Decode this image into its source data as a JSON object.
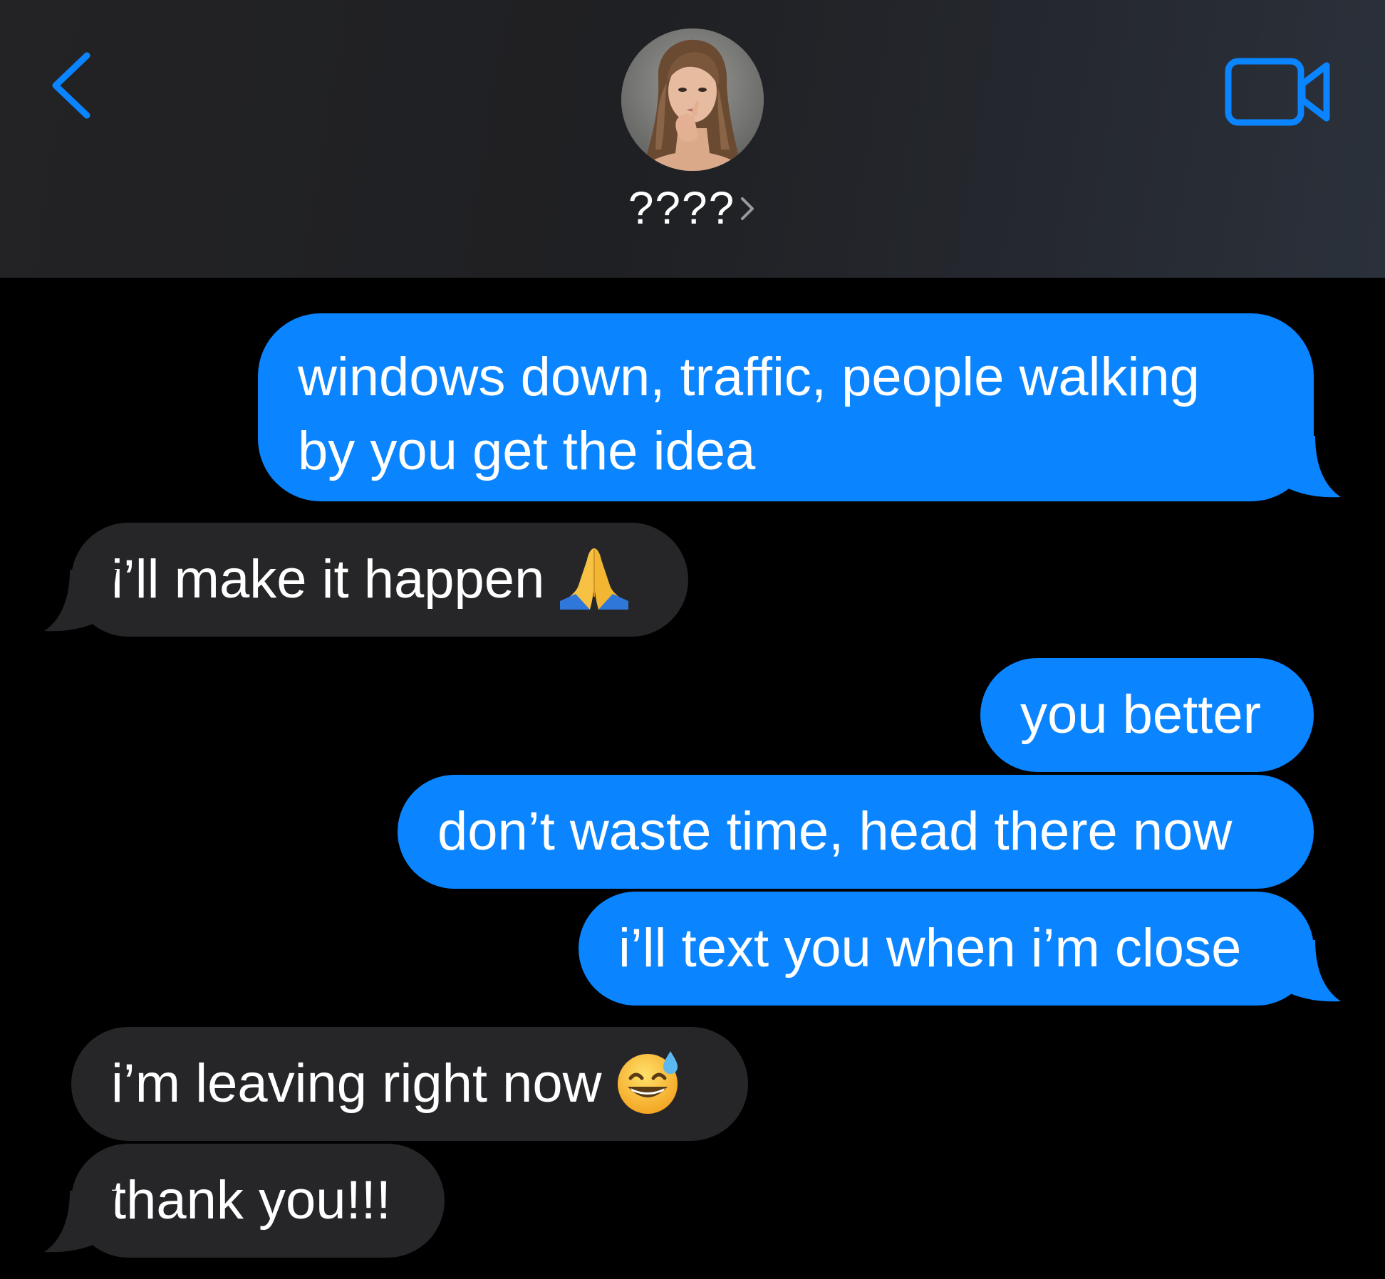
{
  "header": {
    "contact_name": "????",
    "back_icon": "chevron-left-icon",
    "video_icon": "video-camera-icon",
    "details_icon": "chevron-right-icon",
    "accent_color": "#0a84ff"
  },
  "messages": [
    {
      "direction": "sent",
      "line1": "windows down, traffic, people walking",
      "line2": "by you get the idea"
    },
    {
      "direction": "received",
      "text": "i’ll make it happen",
      "emoji": "folded-hands-emoji"
    },
    {
      "direction": "sent",
      "text": "you better"
    },
    {
      "direction": "sent",
      "text": "don’t waste time, head there now"
    },
    {
      "direction": "sent",
      "text": "i’ll text you when i’m close"
    },
    {
      "direction": "received",
      "text": "i’m leaving right now",
      "emoji": "grinning-face-with-sweat-emoji"
    },
    {
      "direction": "received",
      "text": "thank you!!!"
    }
  ],
  "colors": {
    "sent_bubble": "#0a84ff",
    "received_bubble": "#262629",
    "background": "#000000"
  }
}
